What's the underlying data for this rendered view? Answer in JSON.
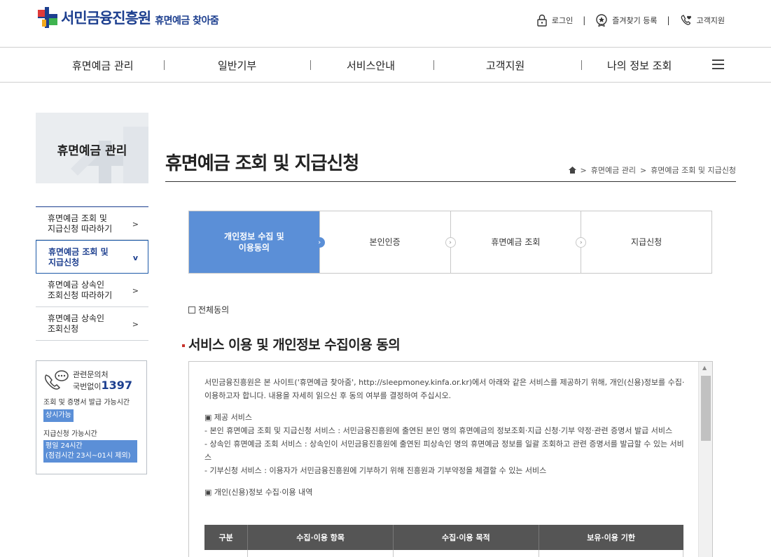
{
  "header": {
    "logo_name": "서민금융진흥원",
    "logo_sub": "휴면예금 찾아줌",
    "util": [
      {
        "label": "로그인",
        "icon": "lock-icon"
      },
      {
        "label": "즐겨찾기 등록",
        "icon": "star-badge-icon"
      },
      {
        "label": "고객지원",
        "icon": "phone-heart-icon"
      }
    ]
  },
  "gnb": {
    "items": [
      "휴면예금 관리",
      "일반기부",
      "서비스안내",
      "고객지원",
      "나의 정보 조회"
    ]
  },
  "lnb": {
    "title": "휴면예금 관리",
    "items": [
      {
        "label": "휴면예금 조회 및 지급신청 따라하기",
        "line1": "휴면예금 조회 및",
        "line2": "지급신청 따라하기",
        "arrow": ">"
      },
      {
        "label": "휴면예금 조회 및 지급신청",
        "line1": "휴면예금 조회 및",
        "line2": "지급신청",
        "arrow": "v"
      },
      {
        "label": "휴면예금 상속인 조회신청 따라하기",
        "line1": "휴면예금 상속인",
        "line2": "조회신청 따라하기",
        "arrow": ">"
      },
      {
        "label": "휴면예금 상속인 조회신청",
        "line1": "휴면예금 상속인",
        "line2": "조회신청",
        "arrow": ">"
      }
    ]
  },
  "contact": {
    "line1": "관련문의처",
    "line2_prefix": "국번없이",
    "number": "1397",
    "cert_label": "조회 및 증명서 발급 가능시간",
    "cert_value": "상시가능",
    "pay_label": "지급신청 가능시간",
    "pay_value_1": "평일 24시간",
    "pay_value_2": "(점검시간 23시~01시 제외)"
  },
  "page": {
    "title": "휴면예금 조회 및 지급신청",
    "breadcrumb": [
      "휴면예금 관리",
      "휴면예금 조회 및 지급신청"
    ]
  },
  "steps": [
    {
      "line1": "개인정보 수집 및",
      "line2": "이용동의",
      "active": true
    },
    {
      "line1": "본인인증",
      "line2": ""
    },
    {
      "line1": "휴면예금 조회",
      "line2": ""
    },
    {
      "line1": "지급신청",
      "line2": ""
    }
  ],
  "agree_all": "전체동의",
  "section_title": "서비스 이용 및 개인정보 수집이용 동의",
  "terms": {
    "intro": "서민금융진흥원은 본 사이트('휴면예금 찾아줌', http://sleepmoney.kinfa.or.kr)에서 아래와 같은 서비스를 제공하기 위해, 개인(신용)정보를 수집·이용하고자 합니다. 내용을 자세히 읽으신 후 동의 여부를 결정하여 주십시오.",
    "service_heading": "▣ 제공 서비스",
    "service_1": "- 본인 휴면예금 조회 및 지급신청 서비스 : 서민금융진흥원에 출연된 본인 명의 휴면예금의 정보조회·지급 신청·기부 약정·관련 증명서 발급 서비스",
    "service_2": "- 상속인 휴면예금 조회 서비스 : 상속인이 서민금융진흥원에 출연된 피상속인 명의 휴면예금 정보를 일괄 조회하고 관련 증명서를 발급할 수 있는 서비스",
    "service_3": "- 기부신청 서비스 : 이용자가 서민금융진흥원에 기부하기 위해 진흥원과 기부약정을 체결할 수 있는 서비스",
    "collect_heading": "▣ 개인(신용)정보 수집·이용 내역",
    "table_headers": [
      "구분",
      "수집·이용 항목",
      "수집·이용 목적",
      "보유·이용 기한"
    ]
  },
  "colors": {
    "brand": "#1d3f8f",
    "step_active": "#5b8fd7",
    "table_header": "#555555",
    "accent_red": "#c8332b"
  }
}
